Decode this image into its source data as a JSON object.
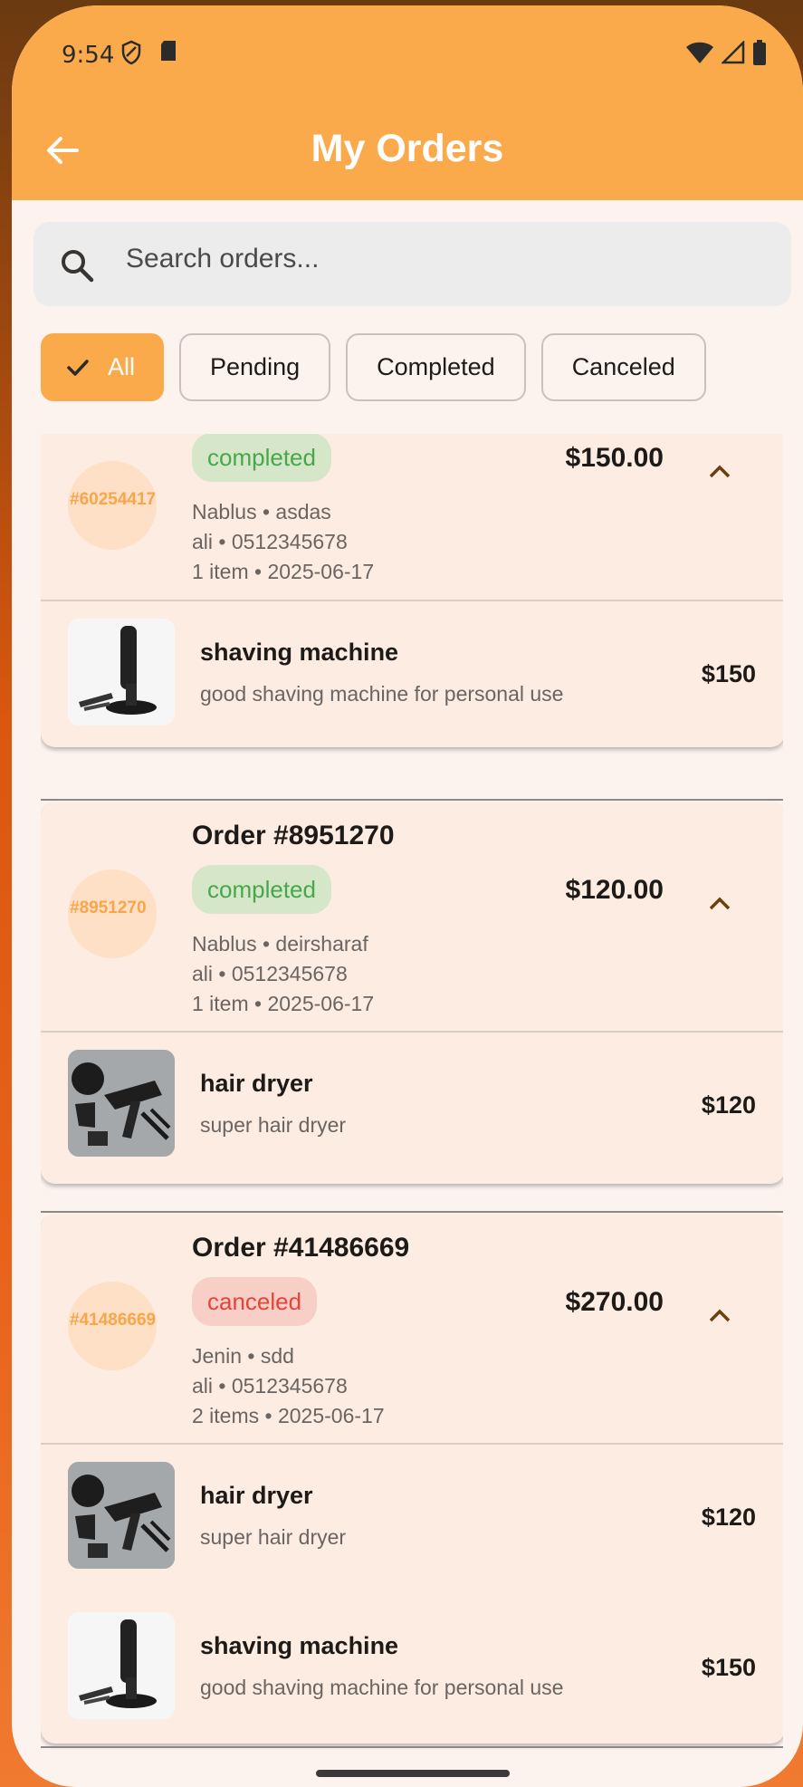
{
  "status_bar": {
    "time": "9:54"
  },
  "header": {
    "title": "My Orders"
  },
  "search": {
    "placeholder": "Search orders..."
  },
  "filters": [
    "All",
    "Pending",
    "Completed",
    "Canceled"
  ],
  "orders": [
    {
      "avatar": "#60254417",
      "status": "completed",
      "price": "$150.00",
      "location": "Nablus • asdas",
      "contact": "ali • 0512345678",
      "summary": "1 item • 2025-06-17",
      "items": [
        {
          "name": "shaving machine",
          "desc": "good shaving machine for personal use",
          "price": "$150"
        }
      ]
    },
    {
      "title": "Order #8951270",
      "avatar": "#8951270",
      "status": "completed",
      "price": "$120.00",
      "location": "Nablus • deirsharaf",
      "contact": "ali • 0512345678",
      "summary": "1 item • 2025-06-17",
      "items": [
        {
          "name": "hair dryer",
          "desc": "super hair dryer",
          "price": "$120"
        }
      ]
    },
    {
      "title": "Order #41486669",
      "avatar": "#41486669",
      "status": "canceled",
      "price": "$270.00",
      "location": "Jenin • sdd",
      "contact": "ali • 0512345678",
      "summary": "2 items • 2025-06-17",
      "items": [
        {
          "name": "hair dryer",
          "desc": "super hair dryer",
          "price": "$120"
        },
        {
          "name": "shaving machine",
          "desc": "good shaving machine for personal use",
          "price": "$150"
        }
      ]
    }
  ],
  "colors": {
    "accent": "#fbaa4b",
    "completed": "#46a84a",
    "canceled": "#e5443a"
  }
}
